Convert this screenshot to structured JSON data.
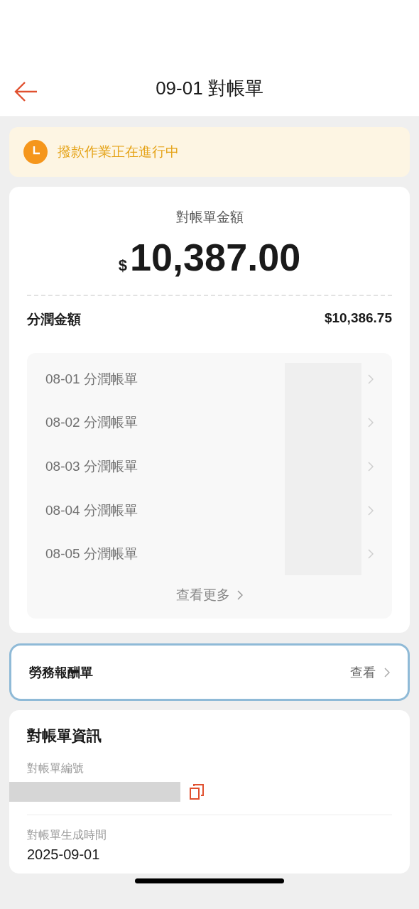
{
  "header": {
    "title": "09-01 對帳單"
  },
  "notice": {
    "text": "撥款作業正在進行中"
  },
  "statement": {
    "label": "對帳單金額",
    "currency": "$",
    "amount": "10,387.00",
    "share_label": "分潤金額",
    "share_amount": "$10,386.75",
    "items": [
      {
        "label": "08-01 分潤帳單"
      },
      {
        "label": "08-02 分潤帳單"
      },
      {
        "label": "08-03 分潤帳單"
      },
      {
        "label": "08-04 分潤帳單"
      },
      {
        "label": "08-05 分潤帳單"
      }
    ],
    "more": "查看更多"
  },
  "labor": {
    "label": "勞務報酬單",
    "action": "查看",
    "selected": true
  },
  "info": {
    "title": "對帳單資訊",
    "fields": [
      {
        "label": "對帳單編號",
        "kind": "copy"
      },
      {
        "label": "對帳單生成時間",
        "kind": "text",
        "value": "2025-09-01"
      }
    ]
  }
}
